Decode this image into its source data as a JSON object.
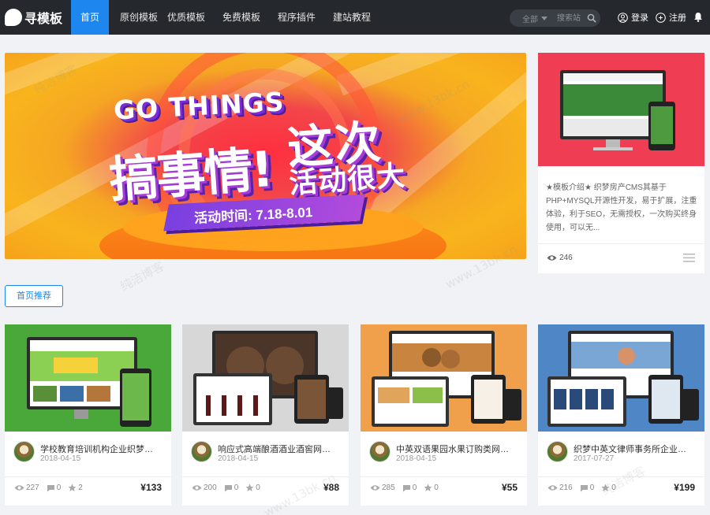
{
  "brand": {
    "name": "寻模板"
  },
  "nav": {
    "items": [
      {
        "label": "首页",
        "active": true
      },
      {
        "label": "原创模板",
        "active": false
      },
      {
        "label": "优质模板",
        "active": false
      },
      {
        "label": "免费模板",
        "active": false
      },
      {
        "label": "程序插件",
        "active": false
      },
      {
        "label": "建站教程",
        "active": false
      }
    ]
  },
  "search": {
    "scope": "全部",
    "placeholder": "搜索站",
    "icon": "search-icon"
  },
  "auth": {
    "login": "登录",
    "register": "注册"
  },
  "colors": {
    "accent": "#1e87ef",
    "topbar": "#25292e",
    "banner_red": "#ef3e54"
  },
  "banner": {
    "headline_en": "GO THINGS",
    "headline_cn_1": "搞事情!",
    "headline_cn_2": "这次",
    "headline_cn_3": "活动很大",
    "date_text": "活动时间: 7.18-8.01",
    "slides": 2,
    "current_slide": 1
  },
  "side_card": {
    "description": "★模板介绍★ 织梦房产CMS其基于PHP+MYSQL开源性开发，易于扩展，注重体验，利于SEO，无需授权，一次购买终身使用，可以无...",
    "views": "246",
    "list_icon": "list-icon"
  },
  "section": {
    "button_label": "首页推荐"
  },
  "products": [
    {
      "title": "学校教育培训机构企业织梦模...",
      "date": "2018-04-15",
      "views": "227",
      "comments": "0",
      "likes": "2",
      "price": "¥133",
      "theme": "#4aa83a"
    },
    {
      "title": "响应式高端酿酒酒业酒窖网站...",
      "date": "2018-04-15",
      "views": "200",
      "comments": "0",
      "likes": "0",
      "price": "¥88",
      "theme": "#d7d7d7"
    },
    {
      "title": "中英双语果园水果订购类网站...",
      "date": "2018-04-15",
      "views": "285",
      "comments": "0",
      "likes": "0",
      "price": "¥55",
      "theme": "#f0a04a"
    },
    {
      "title": "织梦中英文律师事务所企业工...",
      "date": "2017-07-27",
      "views": "216",
      "comments": "0",
      "likes": "0",
      "price": "¥199",
      "theme": "#4f86c6"
    }
  ],
  "watermark": {
    "text_cn": "纯洁博客",
    "text_url": "www.13bk.cn"
  }
}
